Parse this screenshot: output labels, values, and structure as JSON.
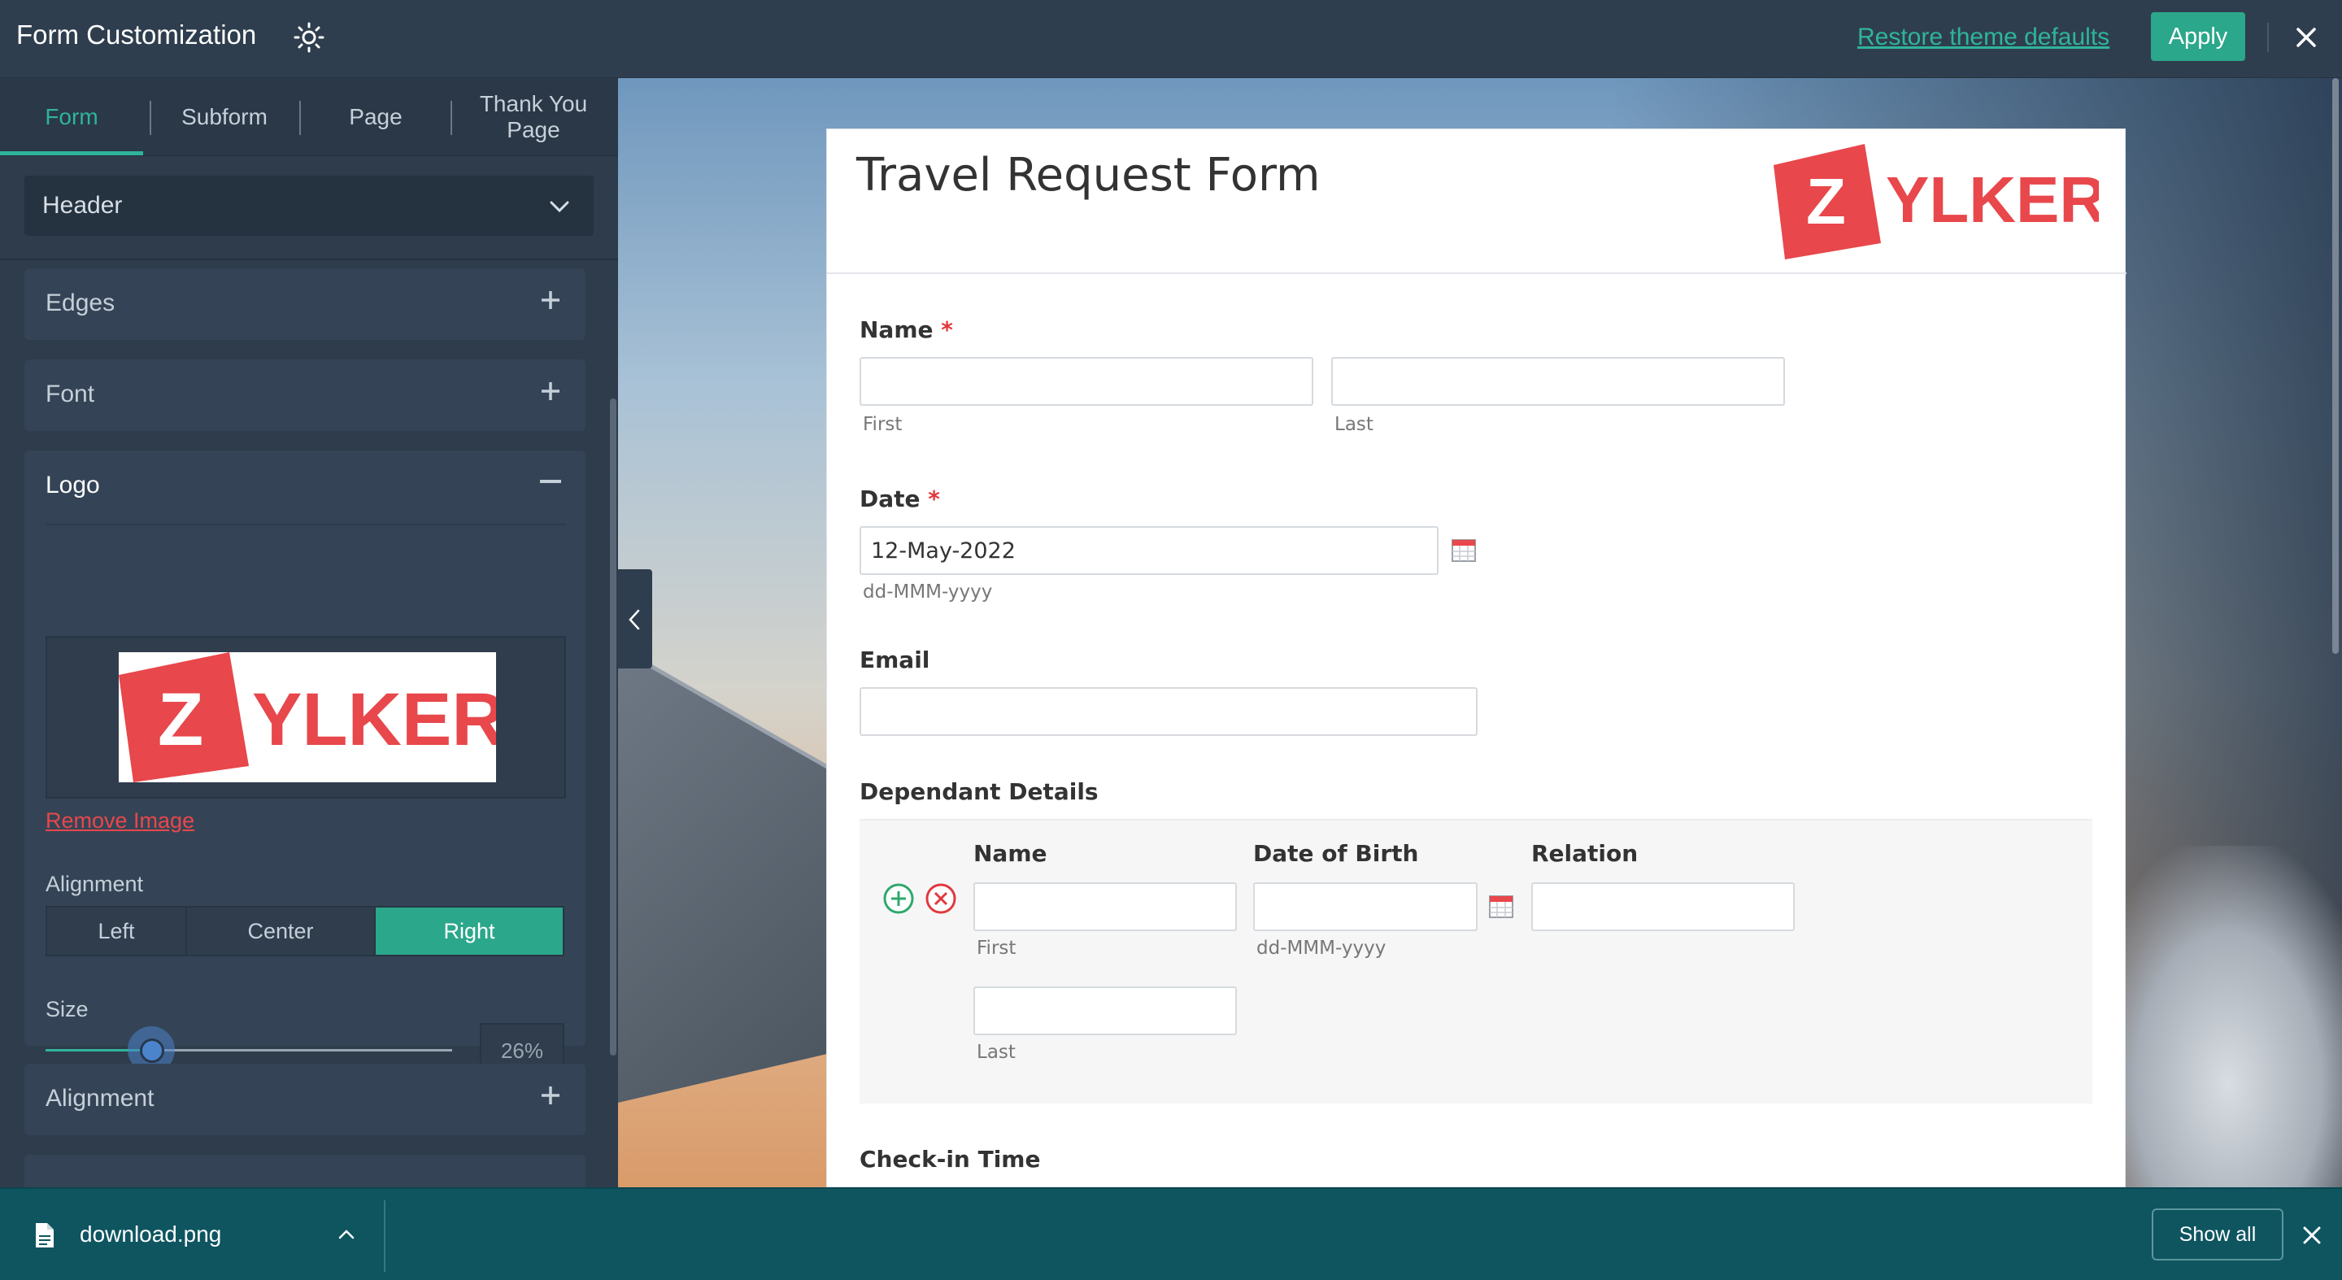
{
  "window": {
    "title": "Form Customization",
    "restore_link": "Restore theme defaults",
    "apply_label": "Apply"
  },
  "sidebar": {
    "tabs": [
      {
        "label": "Form",
        "active": true
      },
      {
        "label": "Subform",
        "active": false
      },
      {
        "label": "Page",
        "active": false
      },
      {
        "label": "Thank You Page",
        "active": false
      }
    ],
    "section_select": "Header",
    "panels": {
      "edges": "Edges",
      "font": "Font",
      "logo": "Logo",
      "alignment": "Alignment"
    },
    "logo": {
      "image_text": "ZYLKER",
      "remove_label": "Remove Image",
      "alignment_label": "Alignment",
      "alignment_options": [
        "Left",
        "Center",
        "Right"
      ],
      "alignment_selected": "Right",
      "size_label": "Size",
      "size_value": "26%",
      "size_percent": 26
    }
  },
  "form": {
    "title": "Travel Request Form",
    "logo_text": "ZYLKER",
    "name_label": "Name",
    "name_first_hint": "First",
    "name_last_hint": "Last",
    "date_label": "Date",
    "date_value": "12-May-2022",
    "date_hint": "dd-MMM-yyyy",
    "email_label": "Email",
    "dependant_label": "Dependant Details",
    "dep_name_col": "Name",
    "dep_dob_col": "Date of Birth",
    "dep_relation_col": "Relation",
    "dep_first_hint": "First",
    "dep_last_hint": "Last",
    "dep_dob_hint": "dd-MMM-yyyy",
    "checkin_label": "Check-in Time",
    "required_mark": "*"
  },
  "download_bar": {
    "file_name": "download.png",
    "show_all": "Show all"
  },
  "colors": {
    "accent": "#2ba78b",
    "brand_red": "#e8474b",
    "topbar": "#2f3e4e",
    "download_bar": "#0e5560"
  }
}
